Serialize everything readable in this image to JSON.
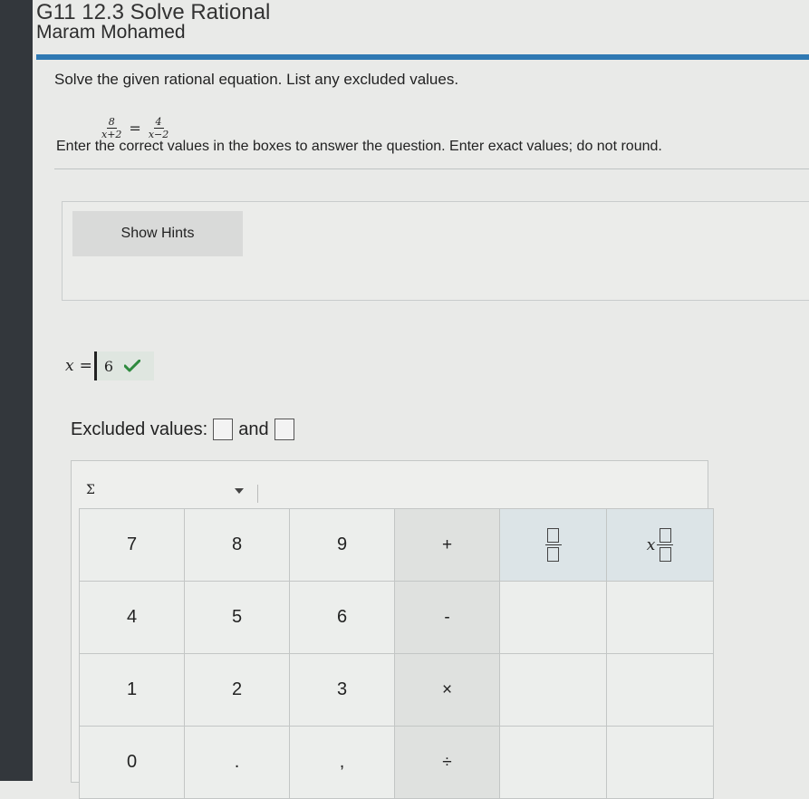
{
  "header": {
    "title": "G11 12.3 Solve Rational",
    "student_name": "Maram Mohamed"
  },
  "question": {
    "prompt": "Solve the given rational equation. List any excluded values.",
    "equation": {
      "left": {
        "numerator": "8",
        "denominator": "x+2"
      },
      "equals": "=",
      "right": {
        "numerator": "4",
        "denominator": "x−2"
      }
    },
    "instruction": "Enter the correct values in the boxes to answer the question. Enter exact values; do not round."
  },
  "hints": {
    "button_label": "Show Hints"
  },
  "answer": {
    "variable": "x",
    "equals": "=",
    "value": "6",
    "status_icon": "check-icon",
    "status_color": "#2e8a3e"
  },
  "excluded": {
    "label": "Excluded values:",
    "joiner": "and",
    "value1": "",
    "value2": ""
  },
  "keypad": {
    "symbol_menu_label": "Σ",
    "digits_row1": [
      "7",
      "8",
      "9"
    ],
    "digits_row2": [
      "4",
      "5",
      "6"
    ],
    "digits_row3": [
      "1",
      "2",
      "3"
    ],
    "digits_row4": [
      "0",
      ".",
      ","
    ],
    "operators": [
      "+",
      "-",
      "×",
      "÷"
    ],
    "templates": [
      {
        "name": "fraction-template-icon"
      },
      {
        "name": "mixed-number-template-icon",
        "variable": "x"
      }
    ]
  }
}
